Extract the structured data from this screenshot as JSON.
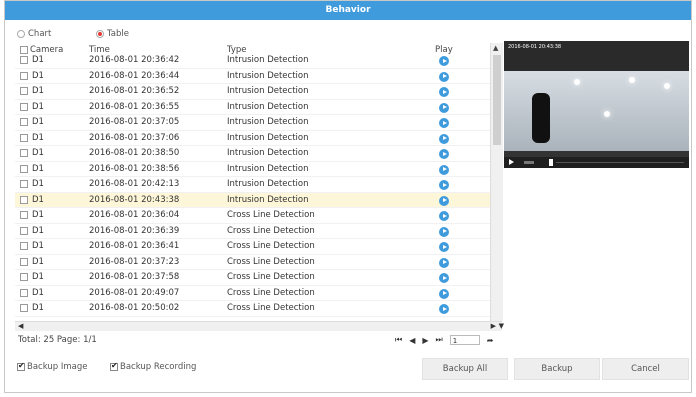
{
  "title": "Behavior",
  "mode": {
    "chart_label": "Chart",
    "table_label": "Table"
  },
  "table": {
    "headers": {
      "camera": "Camera",
      "time": "Time",
      "type": "Type",
      "play": "Play"
    },
    "rows": [
      {
        "camera": "D1",
        "time": "2016-08-01 20:36:42",
        "type": "Intrusion Detection"
      },
      {
        "camera": "D1",
        "time": "2016-08-01 20:36:44",
        "type": "Intrusion Detection"
      },
      {
        "camera": "D1",
        "time": "2016-08-01 20:36:52",
        "type": "Intrusion Detection"
      },
      {
        "camera": "D1",
        "time": "2016-08-01 20:36:55",
        "type": "Intrusion Detection"
      },
      {
        "camera": "D1",
        "time": "2016-08-01 20:37:05",
        "type": "Intrusion Detection"
      },
      {
        "camera": "D1",
        "time": "2016-08-01 20:37:06",
        "type": "Intrusion Detection"
      },
      {
        "camera": "D1",
        "time": "2016-08-01 20:38:50",
        "type": "Intrusion Detection"
      },
      {
        "camera": "D1",
        "time": "2016-08-01 20:38:56",
        "type": "Intrusion Detection"
      },
      {
        "camera": "D1",
        "time": "2016-08-01 20:42:13",
        "type": "Intrusion Detection"
      },
      {
        "camera": "D1",
        "time": "2016-08-01 20:43:38",
        "type": "Intrusion Detection"
      },
      {
        "camera": "D1",
        "time": "2016-08-01 20:36:04",
        "type": "Cross Line Detection"
      },
      {
        "camera": "D1",
        "time": "2016-08-01 20:36:39",
        "type": "Cross Line Detection"
      },
      {
        "camera": "D1",
        "time": "2016-08-01 20:36:41",
        "type": "Cross Line Detection"
      },
      {
        "camera": "D1",
        "time": "2016-08-01 20:37:23",
        "type": "Cross Line Detection"
      },
      {
        "camera": "D1",
        "time": "2016-08-01 20:37:58",
        "type": "Cross Line Detection"
      },
      {
        "camera": "D1",
        "time": "2016-08-01 20:49:07",
        "type": "Cross Line Detection"
      },
      {
        "camera": "D1",
        "time": "2016-08-01 20:50:02",
        "type": "Cross Line Detection"
      }
    ]
  },
  "video": {
    "timestamp": "2016-08-01 20:43:38"
  },
  "footer": {
    "total": "Total: 25  Page: 1/1",
    "page_value": "1"
  },
  "options": {
    "backup_image": "Backup Image",
    "backup_recording": "Backup Recording"
  },
  "buttons": {
    "backup_all": "Backup All",
    "backup": "Backup",
    "cancel": "Cancel"
  },
  "colors": {
    "title_bar": "#3f9bdc",
    "selected_row": "#fdf6d8",
    "play_icon": "#3f9bdc"
  }
}
